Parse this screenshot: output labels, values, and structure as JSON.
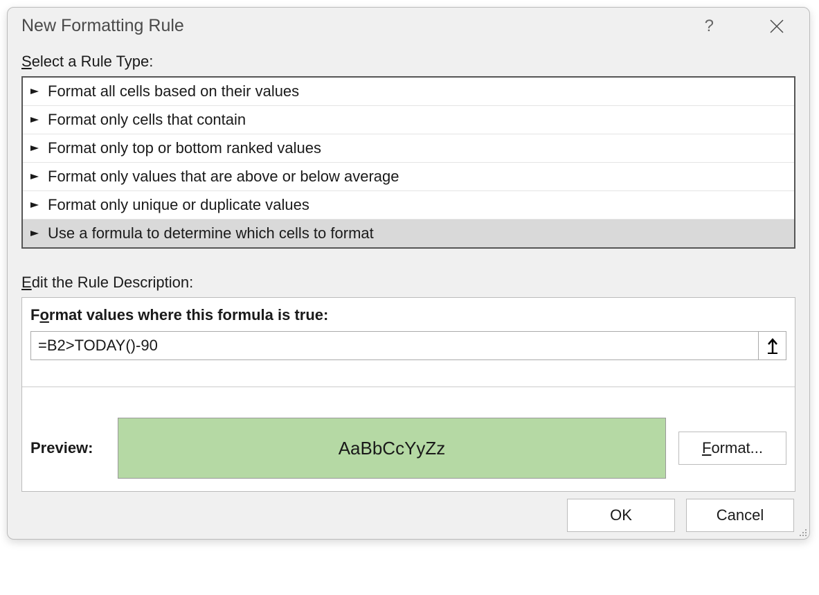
{
  "dialog": {
    "title": "New Formatting Rule",
    "select_label": "Select a Rule Type:",
    "edit_label": "Edit the Rule Description:",
    "rule_types": [
      "Format all cells based on their values",
      "Format only cells that contain",
      "Format only top or bottom ranked values",
      "Format only values that are above or below average",
      "Format only unique or duplicate values",
      "Use a formula to determine which cells to format"
    ],
    "selected_rule_index": 5,
    "formula_label_prefix": "F",
    "formula_label_underline": "o",
    "formula_label_suffix": "rmat values where this formula is true:",
    "formula_value": "=B2>TODAY()-90",
    "preview_label": "Preview:",
    "preview_sample": "AaBbCcYyZz",
    "preview_fill_color": "#b5d9a4",
    "format_btn_underline": "F",
    "format_btn_suffix": "ormat...",
    "ok": "OK",
    "cancel": "Cancel"
  }
}
